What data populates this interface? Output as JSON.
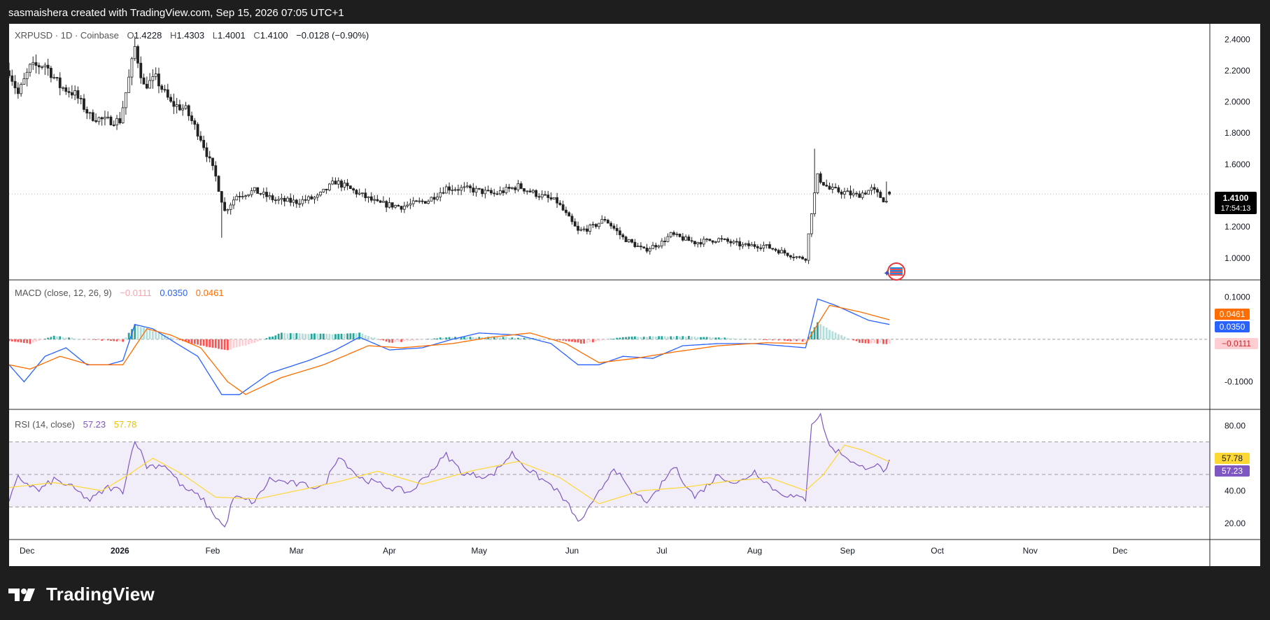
{
  "header": {
    "credit": "sasmaishera created with TradingView.com, Sep 15, 2026 07:05 UTC+1"
  },
  "footer": {
    "brand": "TradingView",
    "logo_icon": "tradingview-logo-icon"
  },
  "colors": {
    "up": "#089981",
    "down": "#f23645",
    "candle": "#222222",
    "macd_line": "#2962ff",
    "signal_line": "#ff6d00",
    "hist_up_strong": "#26a69a",
    "hist_up_weak": "#b2dfdb",
    "hist_down_strong": "#ff5252",
    "hist_down_weak": "#ffcdd2",
    "rsi_line": "#7e57c2",
    "rsi_ma": "#fdd835",
    "rsi_band": "#7e57c2"
  },
  "price_pane": {
    "legend": {
      "symbol": "XRPUSD · 1D · Coinbase",
      "o_label": "O",
      "o": "1.4228",
      "h_label": "H",
      "h": "1.4303",
      "l_label": "L",
      "l": "1.4001",
      "c_label": "C",
      "c": "1.4100",
      "change": "−0.0128 (−0.90%)"
    },
    "last_price": "1.4100",
    "countdown": "17:54:13"
  },
  "macd_pane": {
    "legend": {
      "title": "MACD (close, 12, 26, 9)",
      "hist": "−0.0111",
      "macd": "0.0350",
      "signal": "0.0461"
    },
    "badges": {
      "signal": "0.0461",
      "macd": "0.0350",
      "hist": "−0.0111"
    }
  },
  "rsi_pane": {
    "legend": {
      "title": "RSI (14, close)",
      "rsi": "57.23",
      "ma": "57.78"
    },
    "badges": {
      "ma": "57.78",
      "rsi": "57.23"
    }
  },
  "time_axis": {
    "labels": [
      "Dec",
      "2026",
      "Feb",
      "Mar",
      "Apr",
      "May",
      "Jun",
      "Jul",
      "Aug",
      "Sep",
      "Oct",
      "Nov",
      "Dec"
    ]
  },
  "chart_data": [
    {
      "type": "candlestick",
      "title": "XRPUSD · 1D · Coinbase",
      "ylim": [
        0.86,
        2.5
      ],
      "yticks": [
        "2.4000",
        "2.2000",
        "2.0000",
        "1.8000",
        "1.6000",
        "1.2000",
        "1.0000"
      ],
      "x_range": [
        "2025-11-25",
        "2026-12-31"
      ],
      "anchors": [
        [
          "2025-11-25",
          2.2
        ],
        [
          "2025-11-28",
          2.05
        ],
        [
          "2025-12-02",
          2.22
        ],
        [
          "2025-12-07",
          2.24
        ],
        [
          "2025-12-12",
          2.1
        ],
        [
          "2025-12-17",
          2.05
        ],
        [
          "2025-12-22",
          1.91
        ],
        [
          "2025-12-27",
          1.88
        ],
        [
          "2026-01-01",
          1.88
        ],
        [
          "2026-01-04",
          2.15
        ],
        [
          "2026-01-06",
          2.35
        ],
        [
          "2026-01-09",
          2.1
        ],
        [
          "2026-01-13",
          2.15
        ],
        [
          "2026-01-18",
          1.99
        ],
        [
          "2026-01-23",
          1.95
        ],
        [
          "2026-01-28",
          1.77
        ],
        [
          "2026-02-02",
          1.52
        ],
        [
          "2026-02-05",
          1.3
        ],
        [
          "2026-02-09",
          1.4
        ],
        [
          "2026-02-15",
          1.43
        ],
        [
          "2026-02-22",
          1.37
        ],
        [
          "2026-03-01",
          1.36
        ],
        [
          "2026-03-08",
          1.39
        ],
        [
          "2026-03-14",
          1.49
        ],
        [
          "2026-03-20",
          1.43
        ],
        [
          "2026-03-28",
          1.35
        ],
        [
          "2026-04-05",
          1.33
        ],
        [
          "2026-04-14",
          1.37
        ],
        [
          "2026-04-20",
          1.45
        ],
        [
          "2026-04-28",
          1.44
        ],
        [
          "2026-05-06",
          1.41
        ],
        [
          "2026-05-14",
          1.46
        ],
        [
          "2026-05-20",
          1.41
        ],
        [
          "2026-05-27",
          1.36
        ],
        [
          "2026-06-03",
          1.17
        ],
        [
          "2026-06-08",
          1.2
        ],
        [
          "2026-06-12",
          1.25
        ],
        [
          "2026-06-18",
          1.13
        ],
        [
          "2026-06-25",
          1.05
        ],
        [
          "2026-07-01",
          1.1
        ],
        [
          "2026-07-04",
          1.15
        ],
        [
          "2026-07-12",
          1.1
        ],
        [
          "2026-07-20",
          1.12
        ],
        [
          "2026-07-28",
          1.08
        ],
        [
          "2026-08-04",
          1.08
        ],
        [
          "2026-08-10",
          1.04
        ],
        [
          "2026-08-16",
          1.0
        ],
        [
          "2026-08-18",
          1.0
        ],
        [
          "2026-08-20",
          1.3
        ],
        [
          "2026-08-22",
          1.52
        ],
        [
          "2026-08-26",
          1.44
        ],
        [
          "2026-08-31",
          1.42
        ],
        [
          "2026-09-04",
          1.4
        ],
        [
          "2026-09-09",
          1.44
        ],
        [
          "2026-09-14",
          1.36
        ],
        [
          "2026-09-15",
          1.41
        ]
      ],
      "events": [
        {
          "date": "2026-02-04",
          "low": 1.13
        },
        {
          "date": "2026-01-06",
          "high": 2.42
        },
        {
          "date": "2026-08-21",
          "high": 1.7
        },
        {
          "date": "2026-09-14",
          "high": 1.49
        }
      ],
      "last_candle": {
        "date": "2026-09-15",
        "open": 1.4228,
        "high": 1.4303,
        "low": 1.4001,
        "close": 1.41
      }
    },
    {
      "type": "line",
      "title": "MACD (close, 12, 26, 9)",
      "ylim": [
        -0.165,
        0.14
      ],
      "yticks": [
        "0.1000",
        "-0.1000"
      ],
      "series": [
        {
          "name": "MACD",
          "anchors": [
            [
              "2025-11-25",
              -0.06
            ],
            [
              "2025-11-30",
              -0.1
            ],
            [
              "2025-12-07",
              -0.04
            ],
            [
              "2025-12-14",
              -0.02
            ],
            [
              "2025-12-21",
              -0.06
            ],
            [
              "2025-12-28",
              -0.06
            ],
            [
              "2026-01-02",
              -0.05
            ],
            [
              "2026-01-06",
              0.035
            ],
            [
              "2026-01-12",
              0.025
            ],
            [
              "2026-01-20",
              -0.01
            ],
            [
              "2026-01-27",
              -0.04
            ],
            [
              "2026-02-04",
              -0.13
            ],
            [
              "2026-02-10",
              -0.13
            ],
            [
              "2026-02-20",
              -0.08
            ],
            [
              "2026-03-05",
              -0.05
            ],
            [
              "2026-03-14",
              -0.025
            ],
            [
              "2026-03-22",
              0.005
            ],
            [
              "2026-04-01",
              -0.025
            ],
            [
              "2026-04-12",
              -0.02
            ],
            [
              "2026-04-22",
              0.0
            ],
            [
              "2026-05-01",
              0.015
            ],
            [
              "2026-05-14",
              0.01
            ],
            [
              "2026-05-25",
              -0.01
            ],
            [
              "2026-06-03",
              -0.06
            ],
            [
              "2026-06-10",
              -0.06
            ],
            [
              "2026-06-18",
              -0.04
            ],
            [
              "2026-06-28",
              -0.045
            ],
            [
              "2026-07-08",
              -0.015
            ],
            [
              "2026-07-20",
              -0.01
            ],
            [
              "2026-08-01",
              -0.01
            ],
            [
              "2026-08-18",
              -0.02
            ],
            [
              "2026-08-22",
              0.095
            ],
            [
              "2026-08-28",
              0.08
            ],
            [
              "2026-09-08",
              0.045
            ],
            [
              "2026-09-15",
              0.035
            ]
          ]
        },
        {
          "name": "Signal",
          "anchors": [
            [
              "2025-11-25",
              -0.06
            ],
            [
              "2025-12-02",
              -0.07
            ],
            [
              "2025-12-12",
              -0.04
            ],
            [
              "2025-12-22",
              -0.06
            ],
            [
              "2026-01-02",
              -0.06
            ],
            [
              "2026-01-10",
              0.025
            ],
            [
              "2026-01-18",
              0.01
            ],
            [
              "2026-01-28",
              -0.02
            ],
            [
              "2026-02-06",
              -0.1
            ],
            [
              "2026-02-12",
              -0.13
            ],
            [
              "2026-02-24",
              -0.09
            ],
            [
              "2026-03-10",
              -0.06
            ],
            [
              "2026-03-25",
              -0.015
            ],
            [
              "2026-04-05",
              -0.02
            ],
            [
              "2026-04-22",
              -0.01
            ],
            [
              "2026-05-05",
              0.005
            ],
            [
              "2026-05-18",
              0.015
            ],
            [
              "2026-05-30",
              -0.01
            ],
            [
              "2026-06-10",
              -0.055
            ],
            [
              "2026-06-22",
              -0.045
            ],
            [
              "2026-07-05",
              -0.03
            ],
            [
              "2026-07-20",
              -0.015
            ],
            [
              "2026-08-05",
              -0.008
            ],
            [
              "2026-08-18",
              -0.01
            ],
            [
              "2026-08-26",
              0.08
            ],
            [
              "2026-09-05",
              0.065
            ],
            [
              "2026-09-15",
              0.046
            ]
          ]
        }
      ],
      "histogram": {
        "name": "Histogram",
        "anchors": [
          [
            "2025-11-25",
            -0.005
          ],
          [
            "2025-12-02",
            -0.01
          ],
          [
            "2025-12-10",
            0.008
          ],
          [
            "2025-12-20",
            0.0
          ],
          [
            "2026-01-02",
            -0.005
          ],
          [
            "2026-01-06",
            0.035
          ],
          [
            "2026-01-12",
            0.02
          ],
          [
            "2026-01-22",
            -0.005
          ],
          [
            "2026-02-01",
            -0.02
          ],
          [
            "2026-02-06",
            -0.025
          ],
          [
            "2026-02-14",
            -0.01
          ],
          [
            "2026-02-24",
            0.015
          ],
          [
            "2026-03-14",
            0.012
          ],
          [
            "2026-03-22",
            0.015
          ],
          [
            "2026-04-01",
            -0.008
          ],
          [
            "2026-04-20",
            0.005
          ],
          [
            "2026-05-10",
            0.005
          ],
          [
            "2026-05-25",
            0.0
          ],
          [
            "2026-06-05",
            -0.01
          ],
          [
            "2026-06-18",
            0.006
          ],
          [
            "2026-07-10",
            0.007
          ],
          [
            "2026-08-01",
            0.0
          ],
          [
            "2026-08-18",
            -0.005
          ],
          [
            "2026-08-22",
            0.04
          ],
          [
            "2026-08-28",
            0.015
          ],
          [
            "2026-09-05",
            -0.008
          ],
          [
            "2026-09-15",
            -0.0111
          ]
        ]
      }
    },
    {
      "type": "line",
      "title": "RSI (14, close)",
      "ylim": [
        10,
        90
      ],
      "yticks": [
        "80.00",
        "40.00",
        "20.00"
      ],
      "band": [
        30,
        70
      ],
      "midline": 50,
      "series": [
        {
          "name": "RSI",
          "anchors": [
            [
              "2025-11-25",
              33
            ],
            [
              "2025-11-28",
              48
            ],
            [
              "2025-12-05",
              40
            ],
            [
              "2025-12-10",
              47
            ],
            [
              "2025-12-16",
              42
            ],
            [
              "2025-12-22",
              34
            ],
            [
              "2025-12-28",
              42
            ],
            [
              "2026-01-02",
              40
            ],
            [
              "2026-01-06",
              72
            ],
            [
              "2026-01-10",
              55
            ],
            [
              "2026-01-16",
              56
            ],
            [
              "2026-01-22",
              42
            ],
            [
              "2026-01-28",
              36
            ],
            [
              "2026-02-03",
              22
            ],
            [
              "2026-02-05",
              17
            ],
            [
              "2026-02-08",
              36
            ],
            [
              "2026-02-15",
              33
            ],
            [
              "2026-02-20",
              47
            ],
            [
              "2026-03-01",
              44
            ],
            [
              "2026-03-10",
              42
            ],
            [
              "2026-03-15",
              62
            ],
            [
              "2026-03-22",
              48
            ],
            [
              "2026-04-01",
              42
            ],
            [
              "2026-04-08",
              39
            ],
            [
              "2026-04-20",
              62
            ],
            [
              "2026-04-26",
              50
            ],
            [
              "2026-05-05",
              49
            ],
            [
              "2026-05-12",
              63
            ],
            [
              "2026-05-18",
              52
            ],
            [
              "2026-05-26",
              42
            ],
            [
              "2026-06-01",
              28
            ],
            [
              "2026-06-03",
              20
            ],
            [
              "2026-06-08",
              32
            ],
            [
              "2026-06-15",
              55
            ],
            [
              "2026-06-20",
              40
            ],
            [
              "2026-06-27",
              33
            ],
            [
              "2026-07-05",
              55
            ],
            [
              "2026-07-12",
              36
            ],
            [
              "2026-07-20",
              50
            ],
            [
              "2026-07-26",
              44
            ],
            [
              "2026-08-01",
              52
            ],
            [
              "2026-08-08",
              40
            ],
            [
              "2026-08-14",
              36
            ],
            [
              "2026-08-18",
              35
            ],
            [
              "2026-08-20",
              82
            ],
            [
              "2026-08-23",
              86
            ],
            [
              "2026-08-26",
              67
            ],
            [
              "2026-08-31",
              62
            ],
            [
              "2026-09-05",
              54
            ],
            [
              "2026-09-10",
              56
            ],
            [
              "2026-09-14",
              52
            ],
            [
              "2026-09-15",
              57.23
            ]
          ]
        },
        {
          "name": "RSI-based MA",
          "anchors": [
            [
              "2025-11-25",
              42
            ],
            [
              "2025-12-10",
              45
            ],
            [
              "2025-12-26",
              40
            ],
            [
              "2026-01-04",
              50
            ],
            [
              "2026-01-12",
              60
            ],
            [
              "2026-01-22",
              50
            ],
            [
              "2026-02-02",
              36
            ],
            [
              "2026-02-16",
              35
            ],
            [
              "2026-03-01",
              40
            ],
            [
              "2026-03-16",
              46
            ],
            [
              "2026-03-28",
              52
            ],
            [
              "2026-04-12",
              44
            ],
            [
              "2026-04-28",
              52
            ],
            [
              "2026-05-14",
              58
            ],
            [
              "2026-05-28",
              48
            ],
            [
              "2026-06-10",
              32
            ],
            [
              "2026-06-24",
              40
            ],
            [
              "2026-07-08",
              42
            ],
            [
              "2026-07-24",
              46
            ],
            [
              "2026-08-06",
              48
            ],
            [
              "2026-08-18",
              40
            ],
            [
              "2026-08-24",
              50
            ],
            [
              "2026-08-31",
              68
            ],
            [
              "2026-09-06",
              65
            ],
            [
              "2026-09-15",
              57.78
            ]
          ]
        }
      ]
    }
  ]
}
